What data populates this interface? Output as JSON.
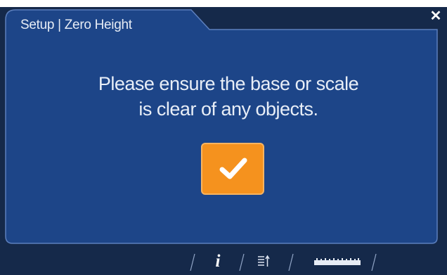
{
  "dialog": {
    "title": "Setup | Zero Height",
    "message_line1": "Please ensure the base or scale",
    "message_line2": "is clear of any objects.",
    "close_glyph": "✕"
  },
  "toolbar": {
    "info_glyph": "i",
    "items": [
      "info-icon",
      "sort-icon",
      "ruler-icon"
    ]
  },
  "colors": {
    "panel": "#1d4588",
    "panel_border": "#5c7fbd",
    "outer_background": "#15294a",
    "confirm_button": "#f5921e",
    "text": "#e8eef7"
  },
  "icons": {
    "close": "close-icon",
    "confirm": "checkmark-icon"
  }
}
